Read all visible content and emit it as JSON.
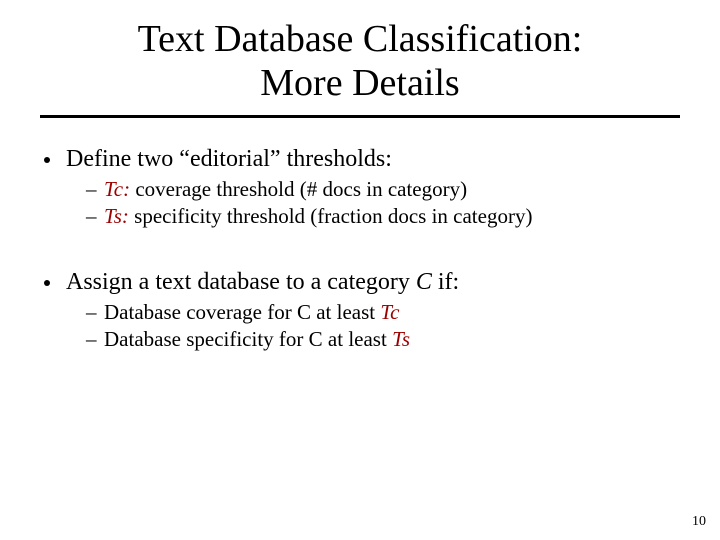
{
  "title_line1": "Text Database Classification:",
  "title_line2": "More Details",
  "bullets": {
    "b1": "Define two “editorial” thresholds:",
    "b1s1_em": "Tc:",
    "b1s1_rest": " coverage threshold (# docs in category)",
    "b1s2_em": "Ts:",
    "b1s2_rest": " specificity threshold (fraction docs in category)",
    "b2_pre": "Assign a text database to a category ",
    "b2_c": "C",
    "b2_post": " if:",
    "b2s1_pre": "Database coverage for C at least ",
    "b2s1_em": "Tc",
    "b2s2_pre": "Database specificity for C at least ",
    "b2s2_em": "Ts"
  },
  "page_number": "10"
}
